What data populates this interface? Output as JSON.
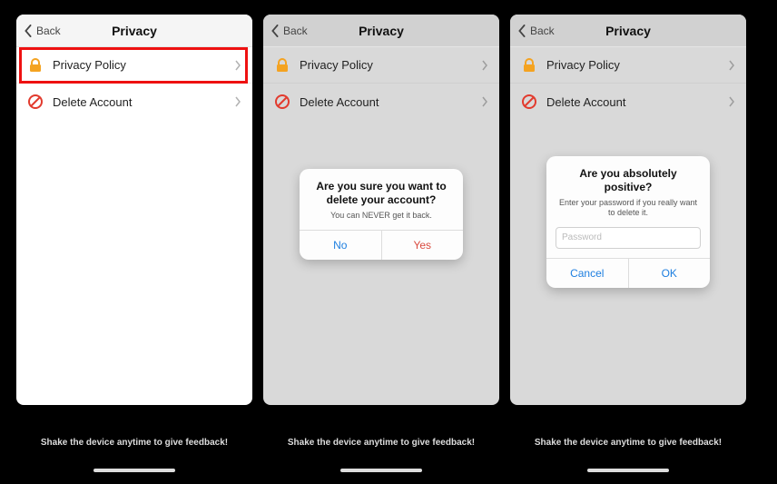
{
  "nav": {
    "back": "Back",
    "title": "Privacy"
  },
  "rows": {
    "privacy_policy": "Privacy Policy",
    "delete_account": "Delete Account"
  },
  "dialog1": {
    "title": "Are you sure you want to delete your account?",
    "sub": "You can NEVER get it back.",
    "no": "No",
    "yes": "Yes"
  },
  "dialog2": {
    "title": "Are you absolutely positive?",
    "sub": "Enter your password if you really want to delete it.",
    "placeholder": "Password",
    "cancel": "Cancel",
    "ok": "OK"
  },
  "footer": "Shake the device anytime to give feedback!"
}
